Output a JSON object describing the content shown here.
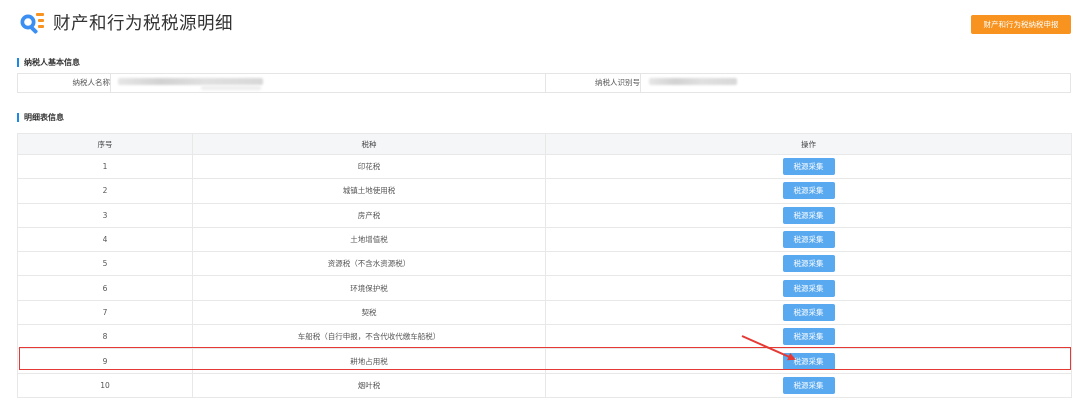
{
  "header": {
    "title": "财产和行为税税源明细",
    "declare_button": "财产和行为税纳税申报"
  },
  "taxpayer_section": {
    "title": "纳税人基本信息",
    "name_label": "纳税人名称",
    "id_label": "纳税人识别号"
  },
  "detail_section": {
    "title": "明细表信息",
    "columns": [
      "序号",
      "税种",
      "操作"
    ],
    "rows": [
      {
        "no": "1",
        "tax": "印花税",
        "action": "税源采集"
      },
      {
        "no": "2",
        "tax": "城镇土地使用税",
        "action": "税源采集"
      },
      {
        "no": "3",
        "tax": "房产税",
        "action": "税源采集"
      },
      {
        "no": "4",
        "tax": "土地增值税",
        "action": "税源采集"
      },
      {
        "no": "5",
        "tax": "资源税（不含水资源税）",
        "action": "税源采集"
      },
      {
        "no": "6",
        "tax": "环境保护税",
        "action": "税源采集"
      },
      {
        "no": "7",
        "tax": "契税",
        "action": "税源采集"
      },
      {
        "no": "8",
        "tax": "车船税（自行申报，不含代收代缴车船税）",
        "action": "税源采集"
      },
      {
        "no": "9",
        "tax": "耕地占用税",
        "action": "税源采集"
      },
      {
        "no": "10",
        "tax": "烟叶税",
        "action": "税源采集"
      }
    ]
  },
  "colors": {
    "accent_orange": "#f7931e",
    "button_blue": "#58a9f0",
    "section_bar_blue": "#1e88e5",
    "highlight_red": "#e53935"
  },
  "icons": {
    "logo": "search-list-icon",
    "annotation": "red-arrow-icon"
  }
}
